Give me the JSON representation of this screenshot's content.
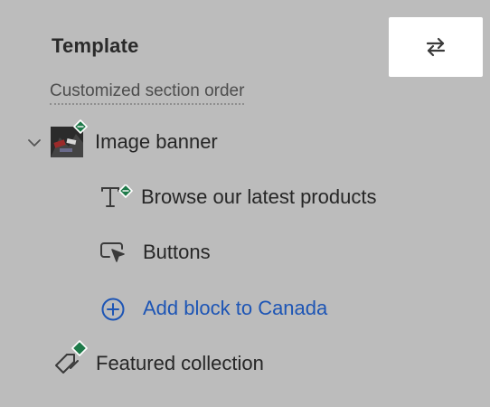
{
  "header": {
    "title": "Template",
    "swap_button_icon": "swap-arrows-icon"
  },
  "subtitle": "Customized section order",
  "sections": [
    {
      "label": "Image banner",
      "icon": "image-thumbnail",
      "expanded": true,
      "blocks": [
        {
          "label": "Browse our latest products",
          "icon": "text-icon"
        },
        {
          "label": "Buttons",
          "icon": "button-cursor-icon"
        },
        {
          "label": "Add block to Canada",
          "icon": "plus-circle-icon"
        }
      ]
    },
    {
      "label": "Featured collection",
      "icon": "tag-icon"
    }
  ],
  "colors": {
    "background": "#bcbcbc",
    "link": "#1d55b5",
    "badge": "#1f7a4a"
  }
}
